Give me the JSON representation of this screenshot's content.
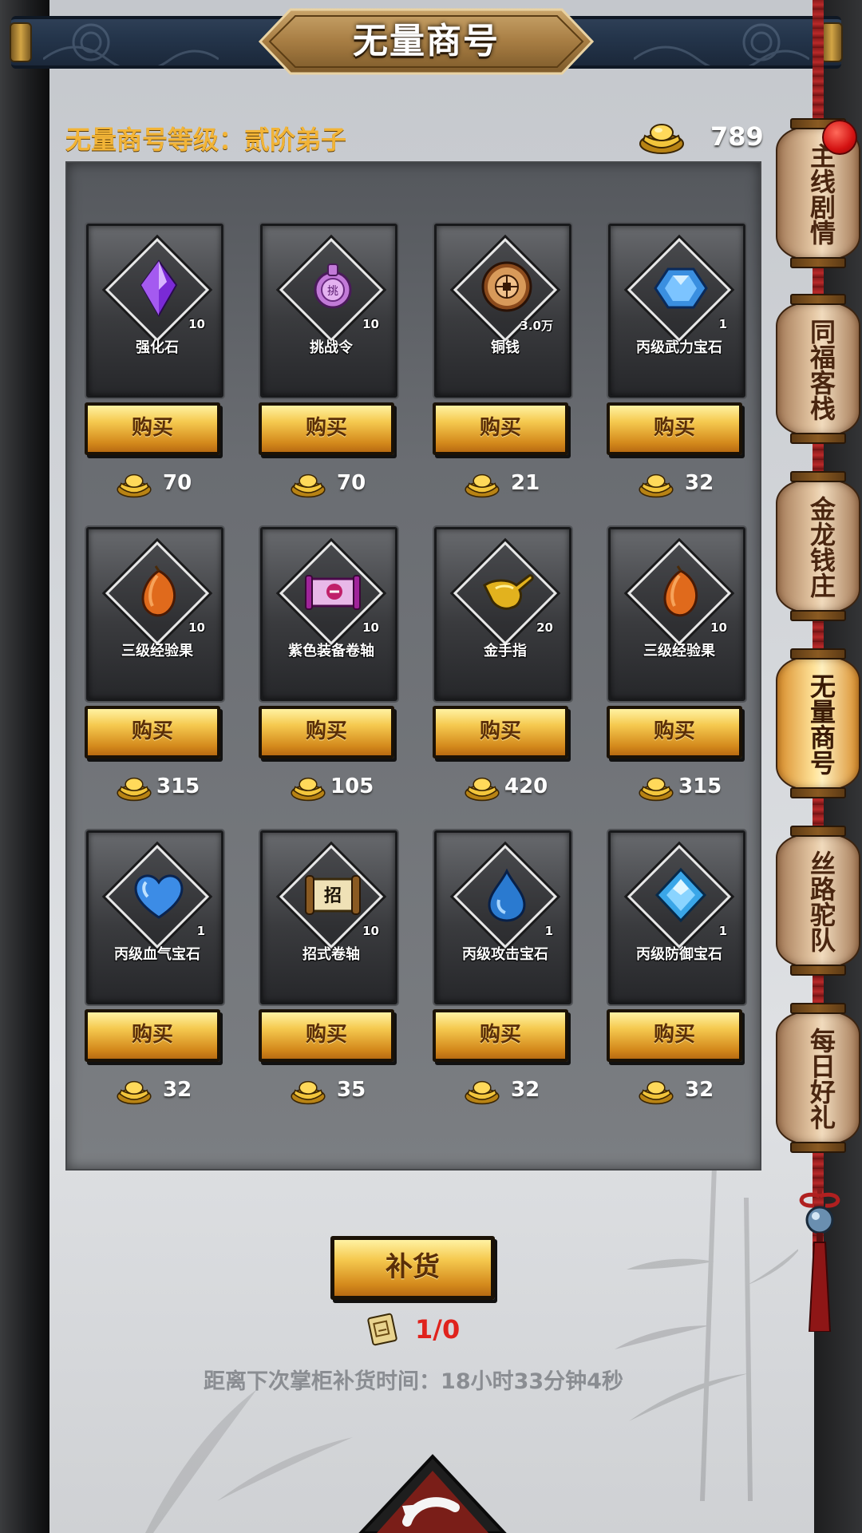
{
  "title": "无量商号",
  "header": {
    "level_text": "无量商号等级：贰阶弟子",
    "gold_total": "789"
  },
  "buy_label": "购买",
  "items": [
    {
      "name": "强化石",
      "count": "10",
      "price": "70",
      "icon": "purple-crystal-icon"
    },
    {
      "name": "挑战令",
      "count": "10",
      "price": "70",
      "icon": "challenge-token-icon"
    },
    {
      "name": "铜钱",
      "count": "3.0万",
      "price": "21",
      "icon": "copper-coin-icon"
    },
    {
      "name": "丙级武力宝石",
      "count": "1",
      "price": "32",
      "icon": "blue-hexagon-gem-icon"
    },
    {
      "name": "三级经验果",
      "count": "10",
      "price": "315",
      "icon": "exp-fruit-icon"
    },
    {
      "name": "紫色装备卷轴",
      "count": "10",
      "price": "105",
      "icon": "purple-scroll-icon"
    },
    {
      "name": "金手指",
      "count": "20",
      "price": "420",
      "icon": "golden-finger-icon"
    },
    {
      "name": "三级经验果",
      "count": "10",
      "price": "315",
      "icon": "exp-fruit-icon"
    },
    {
      "name": "丙级血气宝石",
      "count": "1",
      "price": "32",
      "icon": "blue-heart-gem-icon"
    },
    {
      "name": "招式卷轴",
      "count": "10",
      "price": "35",
      "icon": "skill-scroll-icon"
    },
    {
      "name": "丙级攻击宝石",
      "count": "1",
      "price": "32",
      "icon": "blue-drop-gem-icon"
    },
    {
      "name": "丙级防御宝石",
      "count": "1",
      "price": "32",
      "icon": "blue-diamond-gem-icon"
    }
  ],
  "restock": {
    "button_label": "补货",
    "count": "1/0",
    "timer_text": "距离下次掌柜补货时间：18小时33分钟4秒"
  },
  "side_tabs": [
    {
      "label": "主线剧情",
      "active": false,
      "badge": true
    },
    {
      "label": "同福客栈",
      "active": false
    },
    {
      "label": "金龙钱庄",
      "active": false
    },
    {
      "label": "无量商号",
      "active": true
    },
    {
      "label": "丝路驼队",
      "active": false
    },
    {
      "label": "每日好礼",
      "active": false
    }
  ],
  "colors": {
    "level_text": "#f2b437",
    "restock_count": "#e0231d",
    "timer_text": "#8a8d92"
  }
}
